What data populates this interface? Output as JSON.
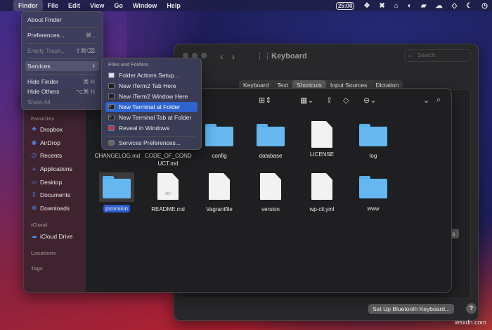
{
  "menubar": {
    "apple": "",
    "items": [
      "Finder",
      "File",
      "Edit",
      "View",
      "Go",
      "Window",
      "Help"
    ],
    "timer": "25:00",
    "tray_icons": [
      "dropbox-icon",
      "klokki-icon",
      "vpn-icon",
      "browser-icon",
      "docker-icon",
      "cloud-icon",
      "shield-icon",
      "moon-icon",
      "clock-icon"
    ]
  },
  "finder_menu": {
    "items": [
      {
        "label": "About Finder",
        "shortcut": ""
      },
      {
        "label": "Preferences...",
        "shortcut": "⌘ ,"
      },
      {
        "label": "Empty Trash...",
        "shortcut": "⇧⌘⌫"
      },
      {
        "label": "Services",
        "shortcut": "›"
      },
      {
        "label": "Hide Finder",
        "shortcut": "⌘ H"
      },
      {
        "label": "Hide Others",
        "shortcut": "⌥⌘ H"
      },
      {
        "label": "Show All",
        "shortcut": ""
      }
    ]
  },
  "services_menu": {
    "header": "Files and Folders",
    "items": [
      "Folder Actions Setup...",
      "New iTerm2 Tab Here",
      "New iTerm2 Window Here",
      "New Terminal at Folder",
      "New Terminal Tab at Folder",
      "Reveal in Windows",
      "Services Preferences..."
    ]
  },
  "keyboard_window": {
    "title": "Keyboard",
    "search_placeholder": "Search",
    "tabs": [
      "Keyboard",
      "Text",
      "Shortcuts",
      "Input Sources",
      "Dictation"
    ],
    "active_tab": "Shortcuts",
    "defaults_button": "ults",
    "bluetooth_button": "Set Up Bluetooth Keyboard...",
    "help": "?"
  },
  "finder": {
    "sidebar": {
      "favorites_label": "Favorites",
      "favorites": [
        "Dropbox",
        "AirDrop",
        "Recents",
        "Applications",
        "Desktop",
        "Documents",
        "Downloads"
      ],
      "icloud_label": "iCloud",
      "icloud": [
        "iCloud Drive"
      ],
      "locations_label": "Locations",
      "tags_label": "Tags"
    },
    "files_row1": [
      "CHANGELOG.md",
      "CODE_OF_COND UCT.md",
      "config",
      "database",
      "LICENSE",
      "log"
    ],
    "files_row2": [
      "provision",
      "README.md",
      "Vagrantfile",
      "version",
      "wp-cli.yml",
      "www"
    ],
    "selected": "provision",
    "md_badge": "MD"
  },
  "watermark": "wsxdn.com"
}
